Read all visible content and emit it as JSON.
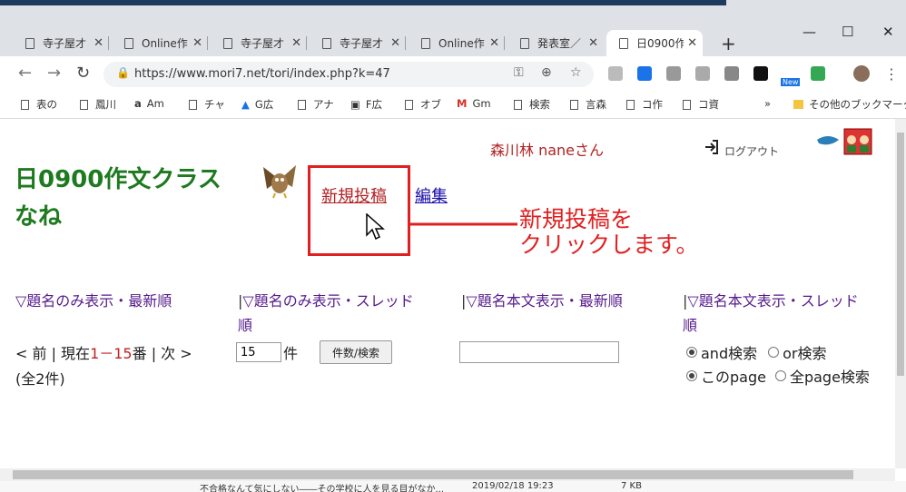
{
  "browser": {
    "tabs": [
      {
        "label": "寺子屋才"
      },
      {
        "label": "Online作"
      },
      {
        "label": "寺子屋才"
      },
      {
        "label": "寺子屋才"
      },
      {
        "label": "Online作"
      },
      {
        "label": "発表室／"
      },
      {
        "label": "日0900作"
      }
    ],
    "new_tab": "+",
    "window": {
      "minimize": "—",
      "maximize": "☐",
      "close": "✕"
    },
    "url": "https://www.mori7.net/tori/index.php?k=47",
    "new_badge": "New",
    "bookmarks": [
      {
        "label": "表の"
      },
      {
        "label": "鳳川"
      },
      {
        "label": "Am"
      },
      {
        "label": "チャ"
      },
      {
        "label": "G広"
      },
      {
        "label": "アナ"
      },
      {
        "label": "F広"
      },
      {
        "label": "オブ"
      },
      {
        "label": "Gm"
      },
      {
        "label": "検索"
      },
      {
        "label": "言森"
      },
      {
        "label": "コ作"
      },
      {
        "label": "コ資"
      }
    ],
    "more_bookmarks": "»",
    "other_bookmarks": "その他のブックマーク"
  },
  "header": {
    "user_name": "森川林 naneさん",
    "logout_label": "ログアウト",
    "site_title": "日0900作文クラスなね",
    "new_post_label": "新規投稿",
    "edit_label": "編集"
  },
  "annotation": {
    "line1": "新規投稿を",
    "line2": "クリックします。"
  },
  "sort": {
    "title_latest": "▽題名のみ表示・最新順",
    "sep": "|",
    "title_thread_1": "▽題名のみ表示・スレッド",
    "title_thread_2": "順",
    "body_latest": "▽題名本文表示・最新順",
    "body_thread_1": "▽題名本文表示・スレッド",
    "body_thread_2": "順"
  },
  "pager": {
    "prev": "< 前 | 現在",
    "range": "1－15",
    "mid": "番 | 次 >",
    "total": "(全2件)"
  },
  "count": {
    "value": "15",
    "unit": "件",
    "button": "件数/検索"
  },
  "search": {
    "and": "and検索",
    "or": "or検索",
    "this_page": "このpage",
    "all_page": "全page検索"
  },
  "underlying_row": {
    "title": "不合格なんて気にしない――その学校に人を見る目がなか...",
    "date": "2019/02/18 19:23",
    "size": "7 KB"
  }
}
